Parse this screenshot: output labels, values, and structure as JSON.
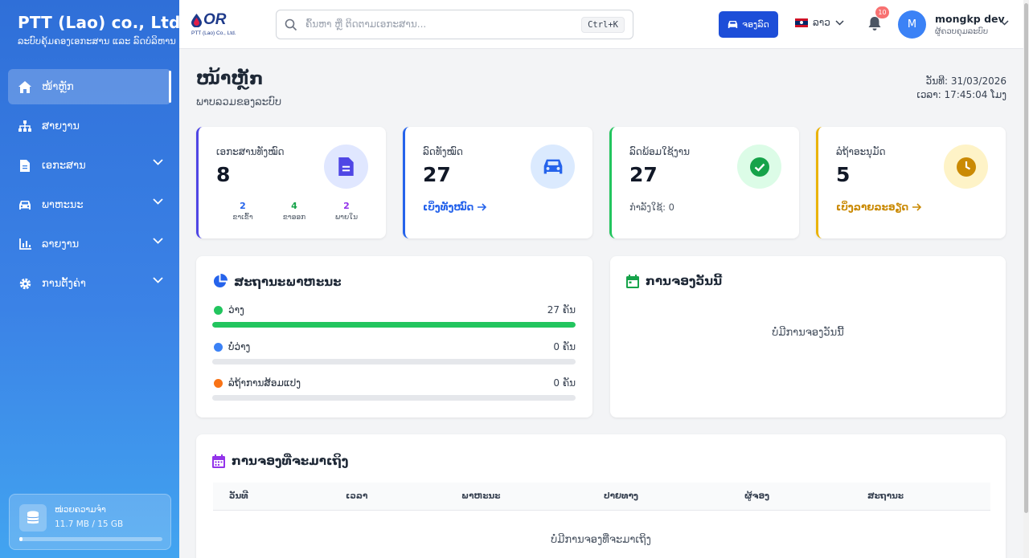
{
  "sidebar": {
    "brand_title": "PTT (Lao) co., Ltd.",
    "brand_subtitle": "ລະບົບຄຸ້ມຄອງເອກະສານ ແລະ ລົດບໍລິຫານ",
    "items": [
      {
        "label": "ໜ້າຫຼັກ",
        "icon": "home-icon",
        "active": true
      },
      {
        "label": "ສາຍງານ",
        "icon": "org-chart-icon"
      },
      {
        "label": "ເອກະສານ",
        "icon": "document-icon"
      },
      {
        "label": "ພາຫະນະ",
        "icon": "car-icon"
      },
      {
        "label": "ລາຍງານ",
        "icon": "bar-chart-icon"
      },
      {
        "label": "ການຕັ້ງຄ່າ",
        "icon": "gear-icon"
      }
    ],
    "storage": {
      "title": "ໜ່ວຍຄວາມຈຳ",
      "value": "11.7 MB / 15 GB",
      "used_fraction": 0.001
    }
  },
  "header": {
    "logo_mark": "OR",
    "logo_sub": "PTT (Lao) Co., Ltd.",
    "search_placeholder": "ຄົ້ນຫາ ຫຼື ຕິດຕາມເອກະສານ...",
    "search_shortcut": "Ctrl+K",
    "book_button": "ຈອງລົດ",
    "language": "ລາວ",
    "notification_count": "10",
    "user_initial": "M",
    "user_name": "mongkp dev",
    "user_role": "ຜູ້ຄວບຄຸມລະບົບ"
  },
  "page": {
    "title": "ໜ້າຫຼັກ",
    "subtitle": "ພາບລວມຂອງລະບົບ",
    "date": "ວັນທີ: 31/03/2026",
    "time": "ເວລາ: 17:45:04 ໂມງ"
  },
  "stats": {
    "documents": {
      "label": "ເອກະສານທັງໝົດ",
      "value": "8",
      "breakdown": [
        {
          "n": "2",
          "t": "ຂາເຂົ້າ"
        },
        {
          "n": "4",
          "t": "ຂາອອກ"
        },
        {
          "n": "2",
          "t": "ພາຍໃນ"
        }
      ]
    },
    "cars": {
      "label": "ລົດທັງໝົດ",
      "value": "27",
      "link": "ເບິ່ງທັງໝົດ"
    },
    "available": {
      "label": "ລົດພ້ອມໃຊ້ງານ",
      "value": "27",
      "note": "ກຳລັງໃຊ້: 0"
    },
    "pending": {
      "label": "ລໍຖ້າອະນຸມັດ",
      "value": "5",
      "link": "ເບິ່ງລາຍລະອຽດ"
    }
  },
  "vehicle_status": {
    "title": "ສະຖານະພາຫະນະ",
    "rows": [
      {
        "label": "ວ່າງ",
        "value": "27 ຄັນ",
        "color": "#22c55e",
        "fraction": 1.0
      },
      {
        "label": "ບໍ່ວ່າງ",
        "value": "0 ຄັນ",
        "color": "#3b82f6",
        "fraction": 0
      },
      {
        "label": "ລໍຖ້າການສ້ອມແປງ",
        "value": "0 ຄັນ",
        "color": "#f97316",
        "fraction": 0
      }
    ]
  },
  "today_booking": {
    "title": "ການຈອງວັນນີ້",
    "empty": "ບໍ່ມີການຈອງວັນນີ້"
  },
  "upcoming": {
    "title": "ການຈອງທີ່ຈະມາເຖິງ",
    "columns": [
      "ວັນທີ",
      "ເວລາ",
      "ພາຫະນະ",
      "ປາຍທາງ",
      "ຜູ້ຈອງ",
      "ສະຖານະ"
    ],
    "empty": "ບໍ່ມີການຈອງທີ່ຈະມາເຖິງ"
  },
  "colors": {
    "primary": "#1d4ed8",
    "documents": "#4f46e5",
    "cars": "#2563eb",
    "available": "#22c55e",
    "pending": "#eab308"
  }
}
